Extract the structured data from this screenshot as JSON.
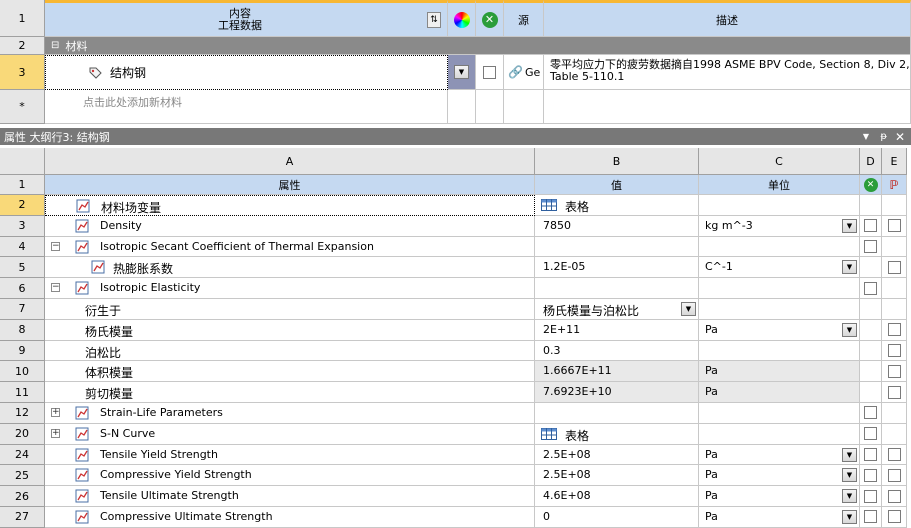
{
  "top_table": {
    "header": {
      "row_num": "1",
      "contents_line1": "内容",
      "contents_line2": "工程数据",
      "source": "源",
      "description": "描述"
    },
    "group_row": {
      "row_num": "2",
      "label": "材料",
      "toggle": "⊟"
    },
    "material_row": {
      "row_num": "3",
      "name": "结构钢",
      "source_text": "Ge",
      "description_line1": "零平均应力下的疲劳数据摘自1998 ASME BPV Code, Section 8, Div 2,",
      "description_line2": "Table 5-110.1"
    },
    "add_row": {
      "row_num": "*",
      "placeholder": "点击此处添加新材料"
    }
  },
  "properties_panel": {
    "title": "属性 大纲行3: 结构钢",
    "pin_icon": "pin-icon",
    "close_icon": "close-icon",
    "col_headers": [
      "A",
      "B",
      "C",
      "D",
      "E"
    ],
    "header_row": {
      "row_num": "1",
      "property": "属性",
      "value": "值",
      "unit": "单位"
    },
    "rows": [
      {
        "num": "2",
        "label": "材料场变量",
        "value": "表格",
        "unit": "",
        "indent": 0,
        "tree": "",
        "icon": true,
        "value_icon": true,
        "unit_dd": false,
        "d_cb": false,
        "e_cb": false,
        "selected": true,
        "value_bg": false
      },
      {
        "num": "3",
        "label": "Density",
        "value": "7850",
        "unit": "kg m^-3",
        "indent": 0,
        "tree": "",
        "icon": true,
        "value_icon": false,
        "unit_dd": true,
        "d_cb": true,
        "e_cb": true,
        "selected": false,
        "value_bg": false
      },
      {
        "num": "4",
        "label": "Isotropic Secant Coefficient of Thermal Expansion",
        "value": "",
        "unit": "",
        "indent": 0,
        "tree": "⊟",
        "icon": true,
        "value_icon": false,
        "unit_dd": false,
        "d_cb": true,
        "e_cb": false,
        "selected": false,
        "value_bg": false
      },
      {
        "num": "5",
        "label": "热膨胀系数",
        "value": "1.2E-05",
        "unit": "C^-1",
        "indent": 1,
        "tree": "",
        "icon": true,
        "value_icon": false,
        "unit_dd": true,
        "d_cb": false,
        "e_cb": true,
        "selected": false,
        "value_bg": false
      },
      {
        "num": "6",
        "label": "Isotropic Elasticity",
        "value": "",
        "unit": "",
        "indent": 0,
        "tree": "⊟",
        "icon": true,
        "value_icon": false,
        "unit_dd": false,
        "d_cb": true,
        "e_cb": false,
        "selected": false,
        "value_bg": false
      },
      {
        "num": "7",
        "label": "衍生于",
        "value": "杨氏模量与泊松比",
        "unit": "",
        "indent": 2,
        "tree": "",
        "icon": false,
        "value_icon": false,
        "unit_dd": false,
        "value_dd": true,
        "d_cb": false,
        "e_cb": false,
        "selected": false,
        "value_bg": false
      },
      {
        "num": "8",
        "label": "杨氏模量",
        "value": "2E+11",
        "unit": "Pa",
        "indent": 2,
        "tree": "",
        "icon": false,
        "value_icon": false,
        "unit_dd": true,
        "d_cb": false,
        "e_cb": true,
        "selected": false,
        "value_bg": false
      },
      {
        "num": "9",
        "label": "泊松比",
        "value": "0.3",
        "unit": "",
        "indent": 2,
        "tree": "",
        "icon": false,
        "value_icon": false,
        "unit_dd": false,
        "d_cb": false,
        "e_cb": true,
        "selected": false,
        "value_bg": false
      },
      {
        "num": "10",
        "label": "体积模量",
        "value": "1.6667E+11",
        "unit": "Pa",
        "indent": 2,
        "tree": "",
        "icon": false,
        "value_icon": false,
        "unit_dd": false,
        "d_cb": false,
        "e_cb": true,
        "selected": false,
        "value_bg": true
      },
      {
        "num": "11",
        "label": "剪切模量",
        "value": "7.6923E+10",
        "unit": "Pa",
        "indent": 2,
        "tree": "",
        "icon": false,
        "value_icon": false,
        "unit_dd": false,
        "d_cb": false,
        "e_cb": true,
        "selected": false,
        "value_bg": true
      },
      {
        "num": "12",
        "label": "Strain-Life Parameters",
        "value": "",
        "unit": "",
        "indent": 0,
        "tree": "⊞",
        "icon": true,
        "value_icon": false,
        "unit_dd": false,
        "d_cb": true,
        "e_cb": false,
        "selected": false,
        "value_bg": false
      },
      {
        "num": "20",
        "label": "S-N Curve",
        "value": "表格",
        "unit": "",
        "indent": 0,
        "tree": "⊞",
        "icon": true,
        "value_icon": true,
        "unit_dd": false,
        "d_cb": true,
        "e_cb": false,
        "selected": false,
        "value_bg": false
      },
      {
        "num": "24",
        "label": "Tensile Yield Strength",
        "value": "2.5E+08",
        "unit": "Pa",
        "indent": 0,
        "tree": "",
        "icon": true,
        "value_icon": false,
        "unit_dd": true,
        "d_cb": true,
        "e_cb": true,
        "selected": false,
        "value_bg": false
      },
      {
        "num": "25",
        "label": "Compressive Yield Strength",
        "value": "2.5E+08",
        "unit": "Pa",
        "indent": 0,
        "tree": "",
        "icon": true,
        "value_icon": false,
        "unit_dd": true,
        "d_cb": true,
        "e_cb": true,
        "selected": false,
        "value_bg": false
      },
      {
        "num": "26",
        "label": "Tensile Ultimate Strength",
        "value": "4.6E+08",
        "unit": "Pa",
        "indent": 0,
        "tree": "",
        "icon": true,
        "value_icon": false,
        "unit_dd": true,
        "d_cb": true,
        "e_cb": true,
        "selected": false,
        "value_bg": false
      },
      {
        "num": "27",
        "label": "Compressive Ultimate Strength",
        "value": "0",
        "unit": "Pa",
        "indent": 0,
        "tree": "",
        "icon": true,
        "value_icon": false,
        "unit_dd": true,
        "d_cb": true,
        "e_cb": true,
        "selected": false,
        "value_bg": false
      }
    ]
  },
  "colors": {
    "header_blue": "#c5d9f1",
    "group_gray": "#8a8a8a",
    "title_bar": "#787878",
    "row_header": "#e6e6e6",
    "readonly_bg": "#e9e9e9"
  }
}
